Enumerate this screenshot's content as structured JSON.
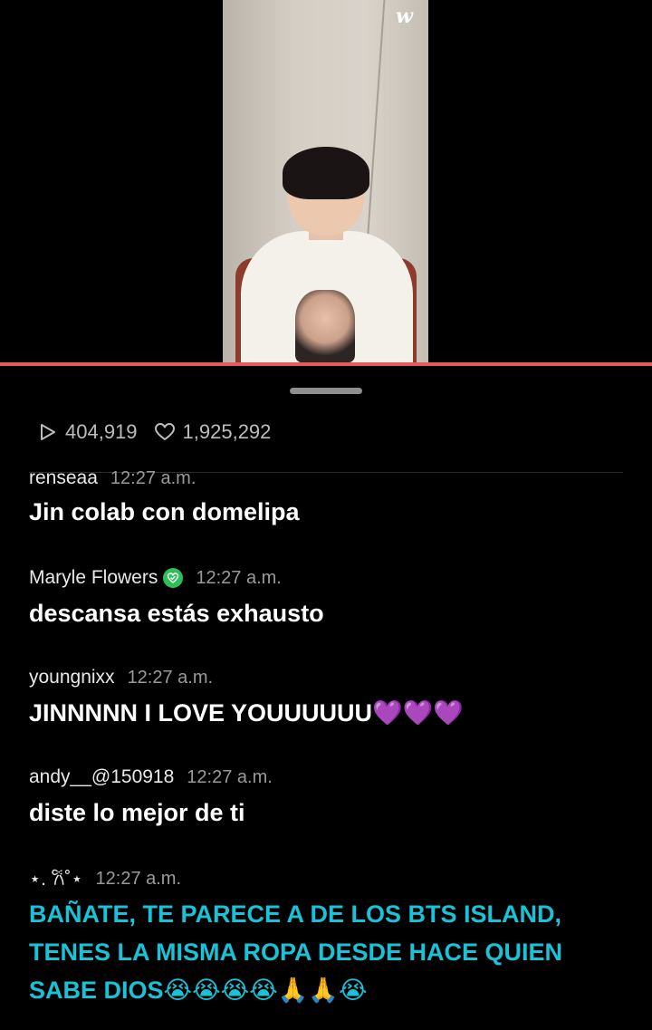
{
  "app": {
    "logo_text": "w"
  },
  "stats": {
    "views": "404,919",
    "likes": "1,925,292"
  },
  "comments": [
    {
      "user": "renseaa",
      "time": "12:27 a.m.",
      "text": "Jin colab con domelipa",
      "verified": false
    },
    {
      "user": "Maryle Flowers",
      "time": "12:27 a.m.",
      "text": "descansa estás exhausto",
      "verified": true
    },
    {
      "user": "youngnixx",
      "time": "12:27 a.m.",
      "text": "JINNNNN I LOVE YOUUUUUU💜💜💜",
      "verified": false
    },
    {
      "user": "andy__@150918",
      "time": "12:27 a.m.",
      "text": "diste lo mejor de ti",
      "verified": false
    },
    {
      "user": "⋆. 𐙚˚⋆",
      "time": "12:27 a.m.",
      "text": "BAÑATE, TE PARECE A DE LOS BTS ISLAND, TENES LA MISMA ROPA DESDE HACE QUIEN SABE DIOS😭😭😭😭🙏🙏😭",
      "verified": false,
      "highlight_color": "#19c2d6"
    }
  ],
  "colors": {
    "accent_line": "#e8585a",
    "verified_badge": "#2fbf5a",
    "highlight_text": "#19c2d6"
  }
}
